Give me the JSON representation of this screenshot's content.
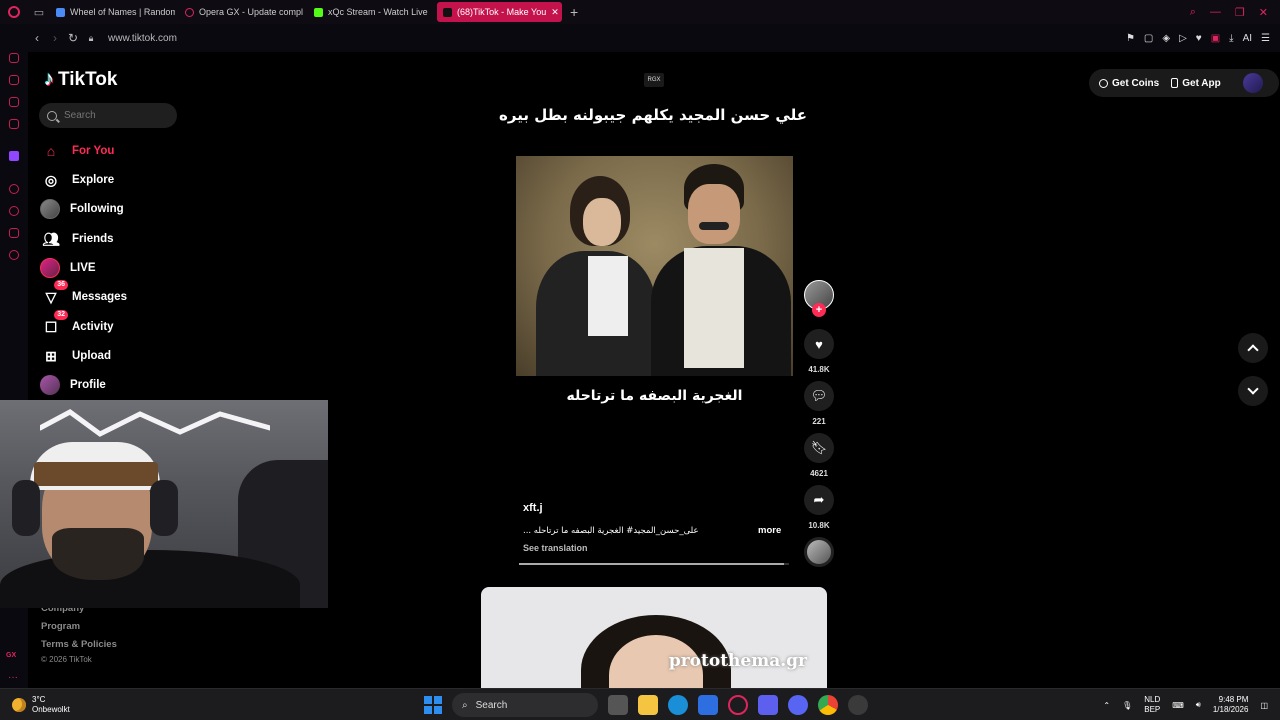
{
  "browser": {
    "tabs": [
      {
        "label": "Wheel of Names | Random",
        "color": "#4b8bf5",
        "active": false
      },
      {
        "label": "Opera GX - Update compl",
        "color": "#e0245e",
        "active": false
      },
      {
        "label": "xQc Stream - Watch Live",
        "color": "#53fc18",
        "active": false
      },
      {
        "label": "(68)TikTok - Make You",
        "color": "#ffffff",
        "active": true
      }
    ],
    "url": "www.tiktok.com",
    "ai_label": "AI"
  },
  "tiktok": {
    "logo_text": "TikTok",
    "search_placeholder": "Search",
    "nav": [
      {
        "label": "For You",
        "icon": "home-icon"
      },
      {
        "label": "Explore",
        "icon": "compass-icon"
      },
      {
        "label": "Following",
        "icon": "following-avatar"
      },
      {
        "label": "Friends",
        "icon": "friends-icon"
      },
      {
        "label": "LIVE",
        "icon": "live-avatar"
      },
      {
        "label": "Messages",
        "icon": "messages-icon",
        "badge": "36"
      },
      {
        "label": "Activity",
        "icon": "activity-icon",
        "badge": "32"
      },
      {
        "label": "Upload",
        "icon": "upload-icon"
      },
      {
        "label": "Profile",
        "icon": "profile-avatar"
      }
    ],
    "footer": {
      "company": "Company",
      "program": "Program",
      "terms": "Terms & Policies",
      "copyright": "© 2026 TikTok"
    },
    "header_buttons": {
      "get_coins": "Get Coins",
      "get_app": "Get App"
    }
  },
  "video": {
    "creator_tag": "RGX",
    "title": "علي حسن المجيد يكلهم جيبولنه بطل بيره",
    "caption": "الغجرية البصفه ما ترتاحله",
    "author": "xft.j",
    "description": "على_حسن_المجيد# الغجرية البصفه ما ترتاحله ...",
    "more": "more",
    "see_translation": "See translation",
    "progress": 0.98,
    "stats": {
      "likes": "41.8K",
      "comments": "221",
      "saves": "4621",
      "shares": "10.8K"
    }
  },
  "next_video": {
    "watermark": "protothema.gr"
  },
  "taskbar": {
    "weather_temp": "3°C",
    "weather_desc": "Onbewolkt",
    "search": "Search",
    "lang_top": "NLD",
    "lang_bottom": "BEP",
    "time": "9:48 PM",
    "date": "1/18/2026"
  }
}
